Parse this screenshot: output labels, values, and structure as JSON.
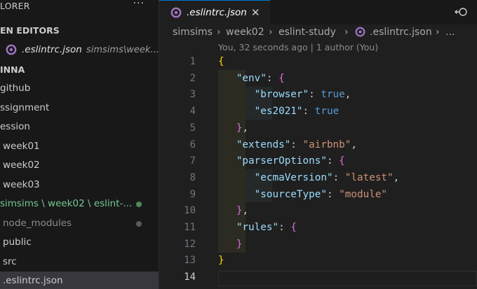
{
  "explorer": {
    "title": "LORER",
    "more": "···",
    "open_editors_title": "EN EDITORS",
    "open_editor": {
      "name": ".eslintrc.json",
      "path": "simsims\\week..."
    },
    "root_title": "INNA",
    "tree": [
      {
        "label": "github"
      },
      {
        "label": "ssignment"
      },
      {
        "label": "ession"
      },
      {
        "label": "week01"
      },
      {
        "label": "week02"
      },
      {
        "label": "week03"
      },
      {
        "label": "simsims \\ week02 \\ eslint-..."
      },
      {
        "label": "node_modules"
      },
      {
        "label": "public"
      },
      {
        "label": "src"
      },
      {
        "label": ".eslintrc.json"
      }
    ],
    "colors": {
      "modified": "#73c991",
      "dot": "#6e6e6e"
    }
  },
  "tab": {
    "label": ".eslintrc.json",
    "close": "✕"
  },
  "breadcrumb": [
    "simsims",
    "week02",
    "eslint-study",
    ".eslintrc.json",
    "..."
  ],
  "blame": "You, 32 seconds ago | 1 author (You)",
  "line_numbers": [
    "1",
    "2",
    "3",
    "4",
    "5",
    "6",
    "7",
    "8",
    "9",
    "10",
    "11",
    "12",
    "13",
    "14"
  ],
  "code": {
    "l1_brace": "{",
    "env_key": "\"env\"",
    "browser_key": "\"browser\"",
    "browser_val": "true",
    "es2021_key": "\"es2021\"",
    "es2021_val": "true",
    "extends_key": "\"extends\"",
    "extends_val": "\"airbnb\"",
    "parser_key": "\"parserOptions\"",
    "ecma_key": "\"ecmaVersion\"",
    "ecma_val": "\"latest\"",
    "source_key": "\"sourceType\"",
    "source_val": "\"module\"",
    "rules_key": "\"rules\"",
    "l13_brace": "}"
  }
}
